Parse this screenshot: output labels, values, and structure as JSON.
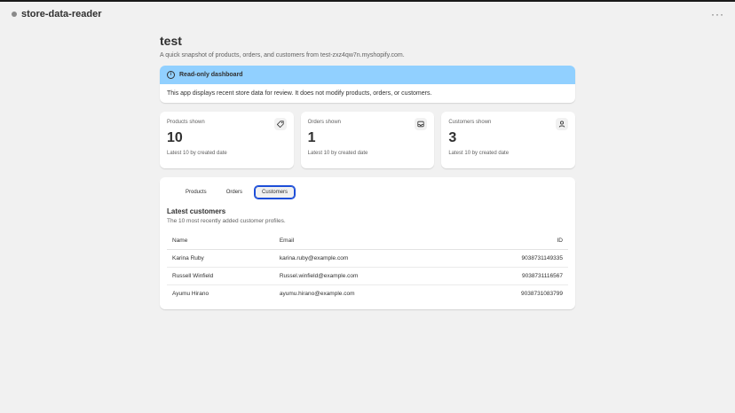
{
  "app": {
    "title": "store-data-reader",
    "more_label": "···"
  },
  "header": {
    "title": "test",
    "subtitle": "A quick snapshot of products, orders, and customers from test-zxz4qw7n.myshopify.com."
  },
  "banner": {
    "title": "Read-only dashboard",
    "body": "This app displays recent store data for review. It does not modify products, orders, or customers.",
    "color": "#91d0ff"
  },
  "stats": [
    {
      "label": "Products shown",
      "value": "10",
      "foot": "Latest 10 by created date",
      "icon": "tag-icon"
    },
    {
      "label": "Orders shown",
      "value": "1",
      "foot": "Latest 10 by created date",
      "icon": "inbox-icon"
    },
    {
      "label": "Customers shown",
      "value": "3",
      "foot": "Latest 10 by created date",
      "icon": "person-icon"
    }
  ],
  "tabs": [
    {
      "label": "Products",
      "active": false
    },
    {
      "label": "Orders",
      "active": false
    },
    {
      "label": "Customers",
      "active": true
    }
  ],
  "section": {
    "title": "Latest customers",
    "subtitle": "The 10 most recently added customer profiles."
  },
  "table": {
    "columns": [
      "Name",
      "Email",
      "ID"
    ],
    "rows": [
      [
        "Karina Ruby",
        "karina.ruby@example.com",
        "9038731149335"
      ],
      [
        "Russell Winfield",
        "Russel.winfield@example.com",
        "9038731116567"
      ],
      [
        "Ayumu Hirano",
        "ayumu.hirano@example.com",
        "9038731083799"
      ]
    ]
  }
}
